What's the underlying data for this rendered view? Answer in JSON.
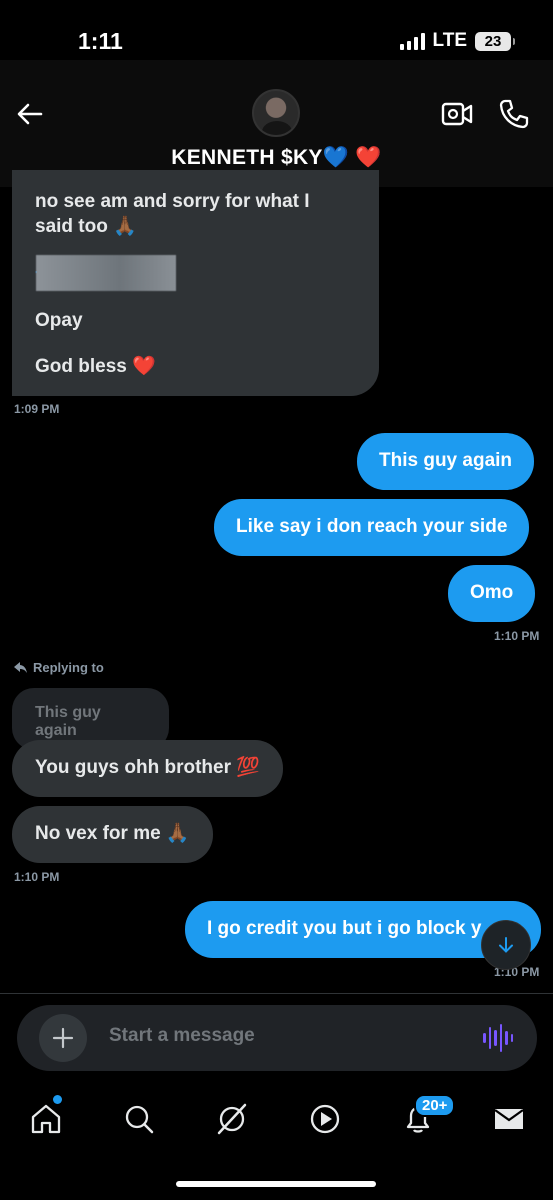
{
  "status_bar": {
    "time": "1:11",
    "network": "LTE",
    "battery": "23"
  },
  "header": {
    "contact_name": "KENNETH $KY💙 ❤️"
  },
  "messages": {
    "incoming_block": {
      "line1": "no see am and sorry for what I",
      "line2": "said too 🙏🏾",
      "line3": "Opay",
      "line4": "God bless ❤️",
      "time": "1:09 PM"
    },
    "out1": "This guy again",
    "out2": "Like say i don reach your side",
    "out3": "Omo",
    "out_time": "1:10 PM",
    "reply_label": "Replying to",
    "quoted_text": "This guy again",
    "in1": "You guys ohh brother 💯",
    "in2": "No vex for me 🙏🏾",
    "in_time": "1:10 PM",
    "out4": "I go credit you but i go block y",
    "out4_time": "1:10 PM"
  },
  "composer": {
    "placeholder": "Start a message"
  },
  "nav": {
    "notifications_badge": "20+"
  },
  "colors": {
    "accent": "#1d9bf0",
    "bubble_in": "#2f3336",
    "voice": "#7856ff"
  }
}
